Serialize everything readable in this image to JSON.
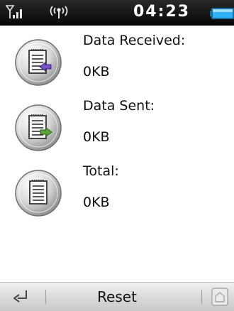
{
  "status_bar": {
    "time": "04:23",
    "icons": [
      "signal-strength-icon",
      "antenna-icon",
      "battery-icon"
    ]
  },
  "rows": [
    {
      "label": "Data Received:",
      "value": "0KB",
      "icon": "document-received-icon",
      "arrow_color": "#7a4fc8"
    },
    {
      "label": "Data Sent:",
      "value": "0KB",
      "icon": "document-sent-icon",
      "arrow_color": "#5aa83a"
    },
    {
      "label": "Total:",
      "value": "0KB",
      "icon": "document-total-icon"
    }
  ],
  "bottom_bar": {
    "back_icon": "back-arrow-icon",
    "reset_label": "Reset",
    "home_icon": "home-icon"
  },
  "colors": {
    "status_bar": "#0a0a0a",
    "battery": "#2fb3ff",
    "bottom_bar": "#d9d9d9"
  }
}
